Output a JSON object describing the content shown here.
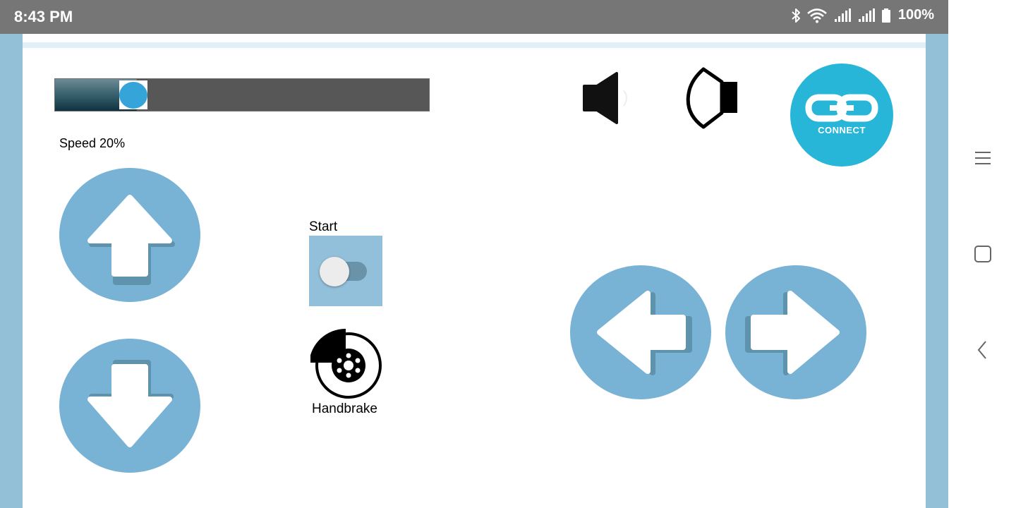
{
  "status_bar": {
    "time": "8:43 PM",
    "battery_percent": "100%",
    "icons": [
      "bluetooth-icon",
      "wifi-icon",
      "signal-icon",
      "signal-icon",
      "battery-icon"
    ]
  },
  "controls": {
    "speed_slider": {
      "value": 0.2
    },
    "speed_label": "Speed 20%",
    "start": {
      "label": "Start",
      "state": "off"
    },
    "handbrake": {
      "label": "Handbrake",
      "icon": "brake-disc-icon"
    },
    "connect": {
      "label": "CONNECT",
      "icon": "chain-link-icon"
    },
    "buttons": [
      "forward-arrow-icon",
      "backward-arrow-icon",
      "left-arrow-icon",
      "right-arrow-icon"
    ],
    "horns": [
      "speaker-icon",
      "speaker-outline-icon"
    ]
  },
  "colors": {
    "button_blue": "#78b2d5",
    "connect_blue": "#27b6d7",
    "frame_blue": "#93bfd7",
    "status_gray": "#767676"
  },
  "nav_bar": [
    "recents-icon",
    "home-icon",
    "back-icon"
  ]
}
